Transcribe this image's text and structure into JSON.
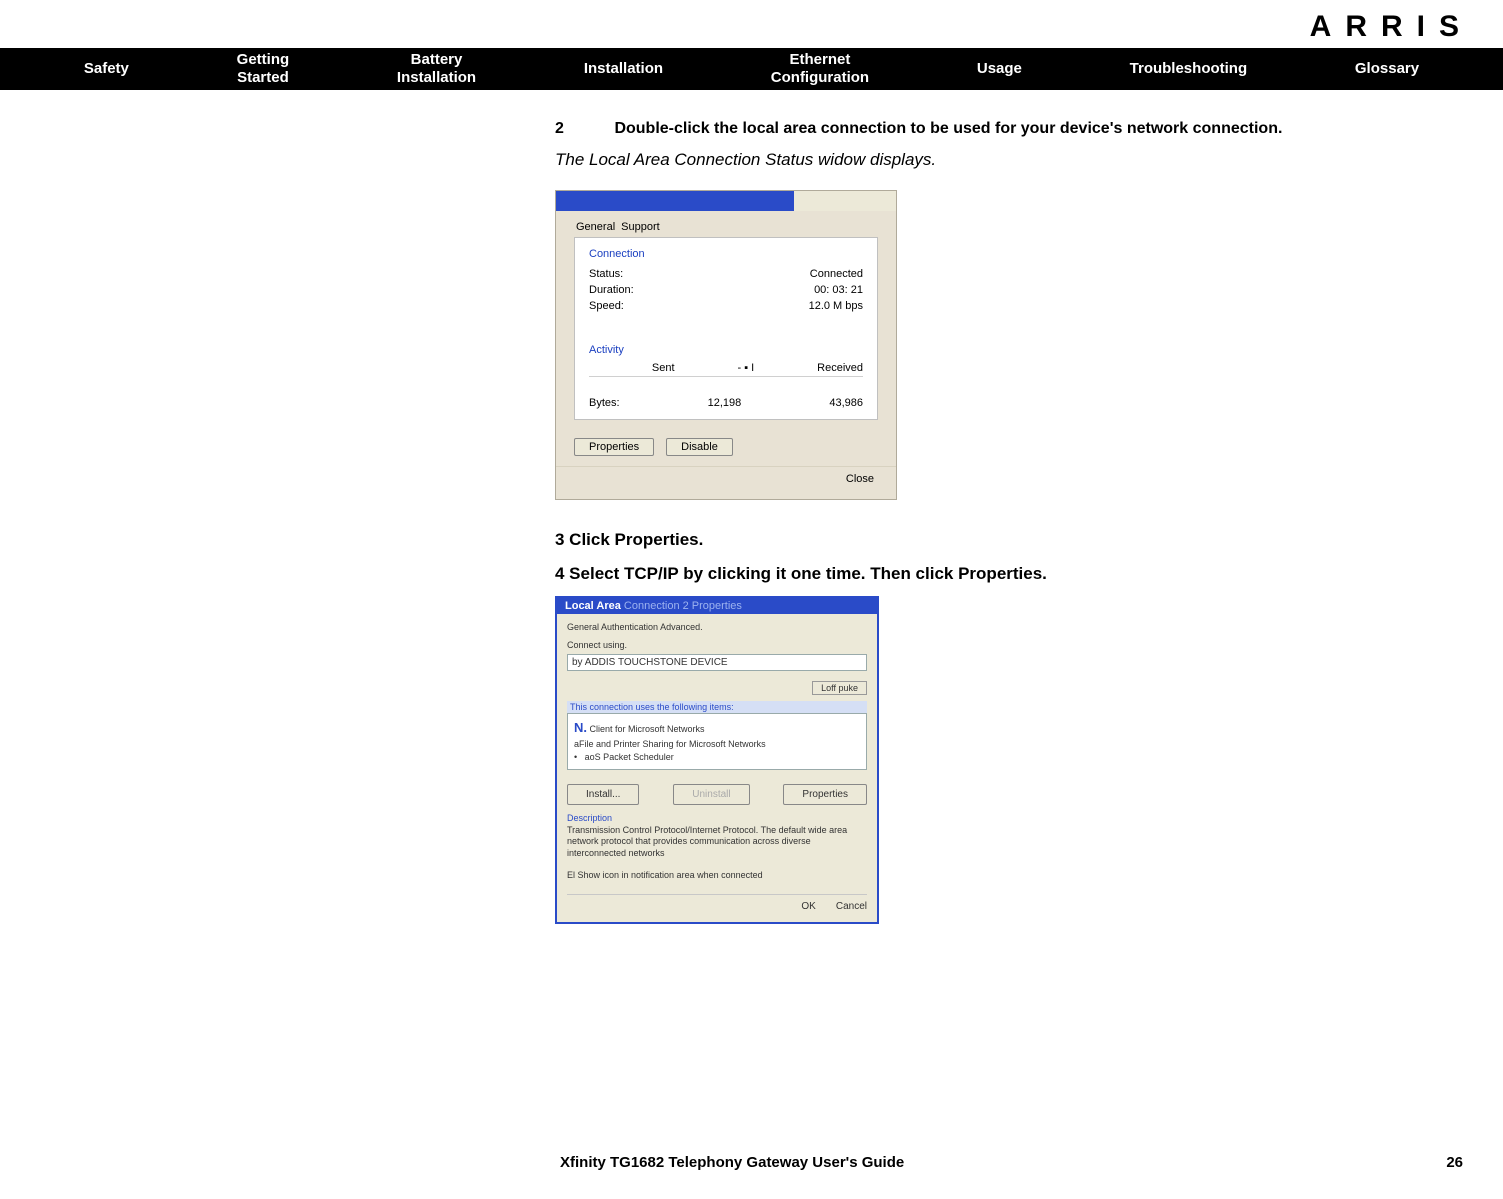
{
  "brand": "ARRIS",
  "nav": {
    "safety": "Safety",
    "getting_started": "Getting\nStarted",
    "battery_install": "Battery\nInstallation",
    "installation": "Installation",
    "ethernet_config": "Ethernet\nConfiguration",
    "usage": "Usage",
    "troubleshooting": "Troubleshooting",
    "glossary": "Glossary"
  },
  "step2": {
    "num": "2",
    "text": "Double-click the local area connection to be used for your device's network connection."
  },
  "note_italic": "The Local Area Connection Status widow displays.",
  "dlg1": {
    "tab_general": "General",
    "tab_support": "Support",
    "grp_connection": "Connection",
    "status_label": "Status:",
    "status_value": "Connected",
    "duration_label": "Duration:",
    "duration_value": "00: 03: 21",
    "speed_label": "Speed:",
    "speed_value": "12.0 M bps",
    "grp_activity": "Activity",
    "sent_label": "Sent",
    "arrow_mid": "- ▪ I",
    "received_label": "Received",
    "bytes_label": "Bytes:",
    "bytes_sent": "12,198",
    "bytes_recv": "43,986",
    "btn_properties": "Properties",
    "btn_disable": "Disable",
    "btn_close": "Close"
  },
  "step3": "3 Click Properties.",
  "step4": "4 Select TCP/IP by clicking it one time. Then click Properties.",
  "dlg2": {
    "title_a": "Local Area ",
    "title_b": "Connection 2 Properties",
    "tabs": "General Authentication Advanced.",
    "connect_using": "Connect using.",
    "device": "by ADDIS TOUCHSTONE DEVICE",
    "configure_btn": "Loff puke",
    "items_header": "This connection uses the following items:",
    "item1_prefix": "N.",
    "item1": " Client for Microsoft Networks",
    "item2": "aFile and Printer Sharing for Microsoft Networks",
    "item3_bullet": "•",
    "item3": "aoS Packet Scheduler",
    "btn_install": "Install...",
    "btn_uninstall": "Uninstall",
    "btn_properties": "Properties",
    "desc_label": "Description",
    "desc_text": "Transmission Control Protocol/Internet Protocol. The default wide area network protocol that provides communication across diverse interconnected networks",
    "checkbox": "El Show icon in notification area when connected",
    "btn_ok": "OK",
    "btn_cancel": "Cancel"
  },
  "footer": {
    "title": "Xfinity TG1682 Telephony Gateway User's Guide",
    "page": "26"
  }
}
